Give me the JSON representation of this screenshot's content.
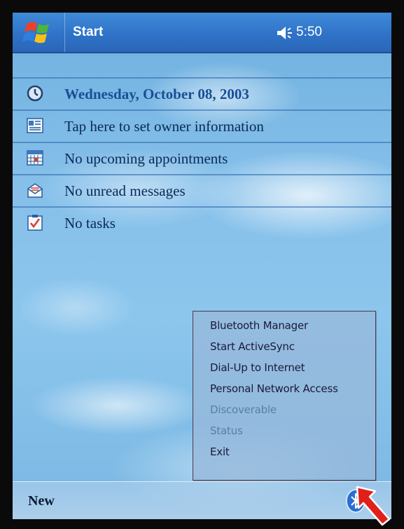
{
  "titlebar": {
    "title": "Start",
    "time": "5:50",
    "start_icon": "windows-flag-icon",
    "volume_icon": "speaker-icon"
  },
  "today": {
    "items": [
      {
        "icon": "clock-icon",
        "label": "Wednesday, October 08, 2003"
      },
      {
        "icon": "owner-card-icon",
        "label": "Tap here to set owner information"
      },
      {
        "icon": "calendar-icon",
        "label": "No upcoming appointments"
      },
      {
        "icon": "envelope-icon",
        "label": "No unread messages"
      },
      {
        "icon": "tasks-icon",
        "label": "No tasks"
      }
    ]
  },
  "bluetooth_menu": {
    "items": [
      {
        "label": "Bluetooth Manager",
        "enabled": true
      },
      {
        "label": "Start ActiveSync",
        "enabled": true
      },
      {
        "label": "Dial-Up to Internet",
        "enabled": true
      },
      {
        "label": "Personal Network Access",
        "enabled": true
      },
      {
        "label": "Discoverable",
        "enabled": false
      },
      {
        "label": "Status",
        "enabled": false
      },
      {
        "label": "Exit",
        "enabled": true
      }
    ]
  },
  "bottombar": {
    "new_label": "New",
    "tray_icon": "bluetooth-icon",
    "pointer_icon": "red-arrow-icon"
  },
  "colors": {
    "titlebar": "#2f73c8",
    "accent_arrow": "#e0201b",
    "bluetooth": "#2a6fd0"
  }
}
